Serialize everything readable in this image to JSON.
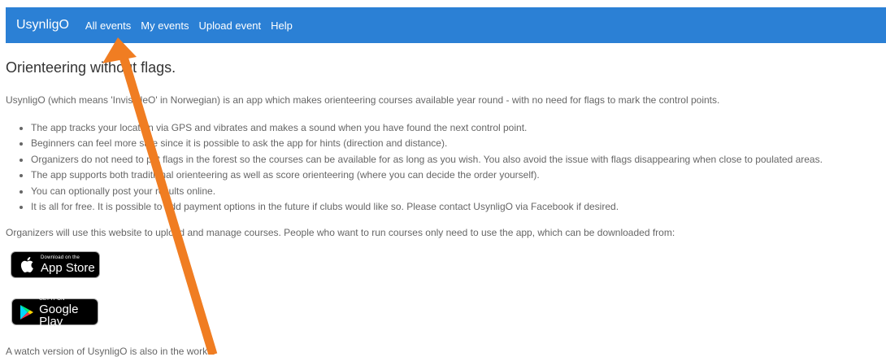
{
  "navbar": {
    "brand": "UsynligO",
    "items": [
      "All events",
      "My events",
      "Upload event",
      "Help"
    ]
  },
  "main": {
    "title": "Orienteering without flags.",
    "intro": "UsynligO (which means 'InvisibleO' in Norwegian) is an app which makes orienteering courses available year round - with no need for flags to mark the control points.",
    "features": [
      "The app tracks your location via GPS and vibrates and makes a sound when you have found the next control point.",
      "Beginners can feel more safe since it is possible to ask the app for hints (direction and distance).",
      "Organizers do not need to put flags in the forest so the courses can be available for as long as you wish. You also avoid the issue with flags disappearing when close to poulated areas.",
      "The app supports both traditional orienteering as well as score orienteering (where you can decide the order yourself).",
      "You can optionally post your results online.",
      "It is all for free. It is possible to add payment options in the future if clubs would like so. Please contact UsynligO via Facebook if desired."
    ],
    "organizers_text": "Organizers will use this website to upload and manage courses. People who want to run courses only need to use the app, which can be downloaded from:",
    "app_store": {
      "small": "Download on the",
      "big": "App Store"
    },
    "google_play": {
      "small": "GET IT ON",
      "big": "Google Play"
    },
    "watch_text": "A watch version of UsynligO is also in the works."
  },
  "annotation": {
    "color": "#f07d22",
    "icon": "arrow-icon"
  }
}
